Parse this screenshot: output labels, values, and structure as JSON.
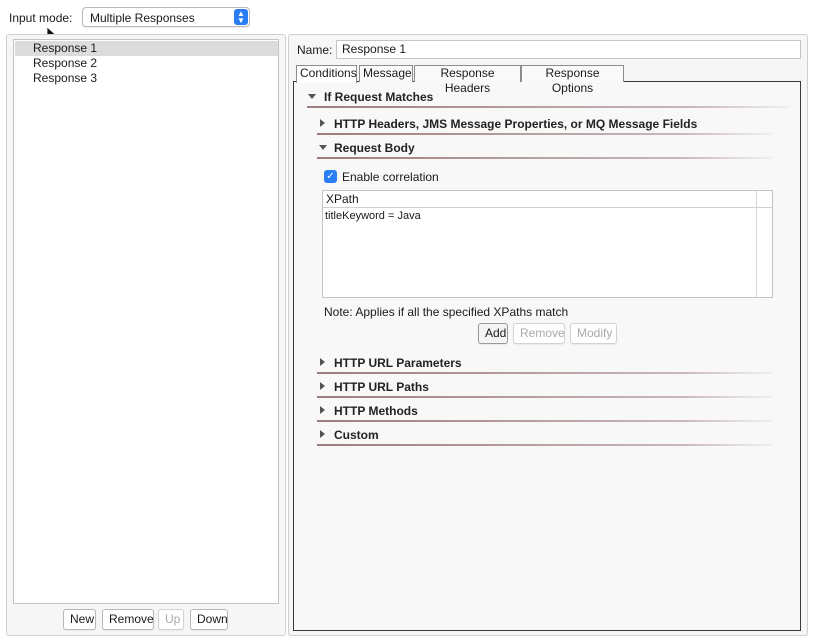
{
  "input_mode": {
    "label": "Input mode:",
    "selected": "Multiple Responses"
  },
  "responses": {
    "items": [
      "Response 1",
      "Response 2",
      "Response 3"
    ],
    "selected_index": 0,
    "buttons": {
      "new": "New",
      "remove": "Remove",
      "up": "Up",
      "down": "Down"
    }
  },
  "editor": {
    "name_label": "Name:",
    "name_value": "Response 1",
    "tabs": [
      "Conditions",
      "Message",
      "Response Headers",
      "Response Options"
    ],
    "active_tab": "Conditions"
  },
  "conditions": {
    "main_section": "If Request Matches",
    "headers_section": "HTTP Headers, JMS Message Properties, or MQ Message Fields",
    "body_section": "Request Body",
    "enable_correlation": "Enable correlation",
    "enable_correlation_checked": true,
    "xpath_header": "XPath",
    "xpath_rows": [
      "titleKeyword = Java"
    ],
    "note": "Note: Applies if all the specified XPaths match",
    "add": "Add",
    "remove": "Remove",
    "modify": "Modify",
    "url_params_section": "HTTP URL Parameters",
    "url_paths_section": "HTTP URL Paths",
    "methods_section": "HTTP Methods",
    "custom_section": "Custom"
  },
  "colors": {
    "accent": "#2a7ef4",
    "section_rule": "#9c7d7d",
    "selection": "#dcdcdc"
  }
}
